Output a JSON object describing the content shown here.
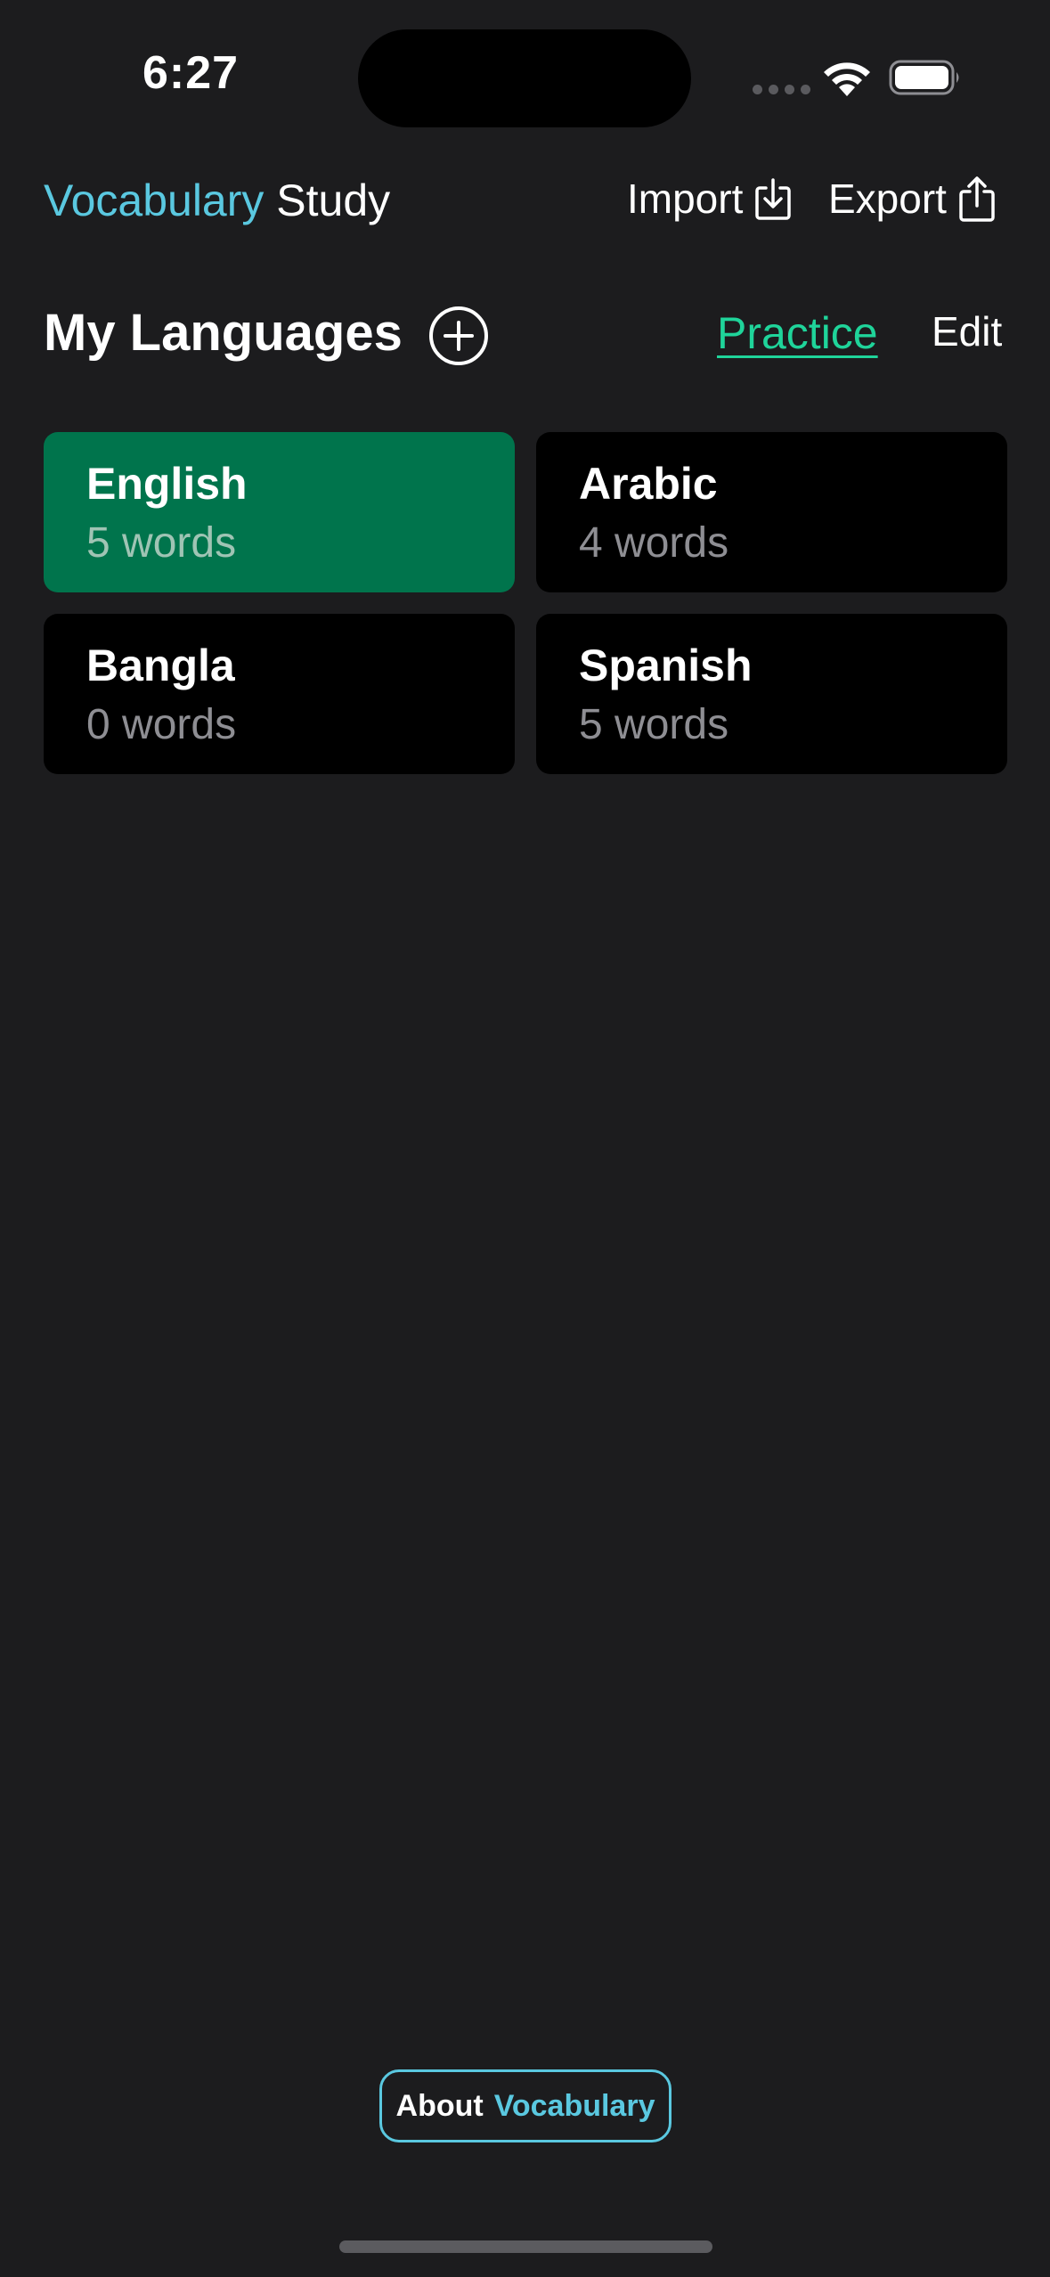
{
  "status_bar": {
    "time": "6:27"
  },
  "header": {
    "title_accent": "Vocabulary",
    "title_rest": "Study",
    "import_label": "Import",
    "import_icon": "download-tray-icon",
    "export_label": "Export",
    "export_icon": "share-icon"
  },
  "section": {
    "title": "My Languages",
    "add_icon": "plus-circle-icon",
    "practice_label": "Practice",
    "edit_label": "Edit"
  },
  "languages": [
    {
      "name": "English",
      "count": "5 words",
      "selected": true
    },
    {
      "name": "Arabic",
      "count": "4 words",
      "selected": false
    },
    {
      "name": "Bangla",
      "count": "0 words",
      "selected": false
    },
    {
      "name": "Spanish",
      "count": "5 words",
      "selected": false
    }
  ],
  "about": {
    "label_plain": "About",
    "label_accent": "Vocabulary"
  },
  "colors": {
    "background": "#1c1c1e",
    "accent_blue": "#5ac8e0",
    "accent_green": "#1fd49a",
    "selected_card": "#00744c",
    "card": "#000000"
  }
}
